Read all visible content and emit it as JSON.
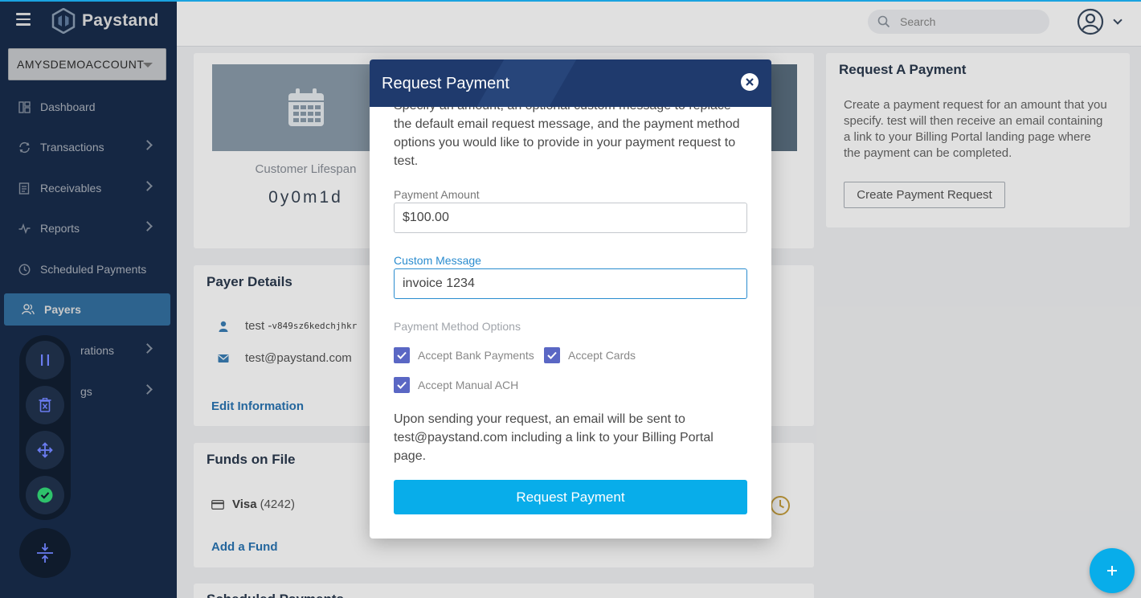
{
  "app": {
    "brand": "Paystand"
  },
  "account_selector": {
    "value": "AMYSDEMOACCOUNT"
  },
  "sidebar": {
    "items": [
      {
        "label": "Dashboard",
        "icon": "dashboard-icon"
      },
      {
        "label": "Transactions",
        "icon": "transactions-icon"
      },
      {
        "label": "Receivables",
        "icon": "receivables-icon"
      },
      {
        "label": "Reports",
        "icon": "reports-icon"
      },
      {
        "label": "Scheduled Payments",
        "icon": "clock-icon"
      },
      {
        "label": "Payers",
        "icon": "payers-icon"
      },
      {
        "label": "rations",
        "icon": "integrations-icon"
      },
      {
        "label": "gs",
        "icon": "settings-icon"
      }
    ]
  },
  "topbar": {
    "search_placeholder": "Search"
  },
  "customer_stats": {
    "label": "Customer Lifespan",
    "value": "0y0m1d"
  },
  "payer_details": {
    "title": "Payer Details",
    "name": "test - ",
    "id_fragment": "v849sz6kedchjhkr",
    "email": "test@paystand.com",
    "edit_link": "Edit Information"
  },
  "funds_on_file": {
    "title": "Funds on File",
    "card_brand": "Visa",
    "card_last4": "(4242)",
    "add_link": "Add a Fund"
  },
  "scheduled_payments": {
    "title": "Scheduled Payments"
  },
  "request_card": {
    "title": "Request A Payment",
    "description": "Create a payment request for an amount that you specify. test will then receive an email containing a link to your Billing Portal landing page where the payment can be completed.",
    "button": "Create Payment Request"
  },
  "modal": {
    "title": "Request Payment",
    "intro": "Specify an amount, an optional custom message to replace the default email request message, and the payment method options you would like to provide in your payment request to test.",
    "amount_label": "Payment Amount",
    "amount_value": "$100.00",
    "message_label": "Custom Message",
    "message_value": "invoice 1234",
    "payment_methods_title": "Payment Method Options",
    "options": [
      {
        "label": "Accept Bank Payments",
        "checked": true
      },
      {
        "label": "Accept Cards",
        "checked": true
      },
      {
        "label": "Accept Manual ACH",
        "checked": true
      }
    ],
    "note": "Upon sending your request, an email will be sent to test@paystand.com including a link to your Billing Portal page.",
    "submit": "Request Payment"
  },
  "colors": {
    "sidebar": "#1c3356",
    "active_nav": "#3b7fb5",
    "modal_header": "#1f3a6d",
    "primary_button": "#08adea",
    "checkbox": "#5a67c4"
  }
}
